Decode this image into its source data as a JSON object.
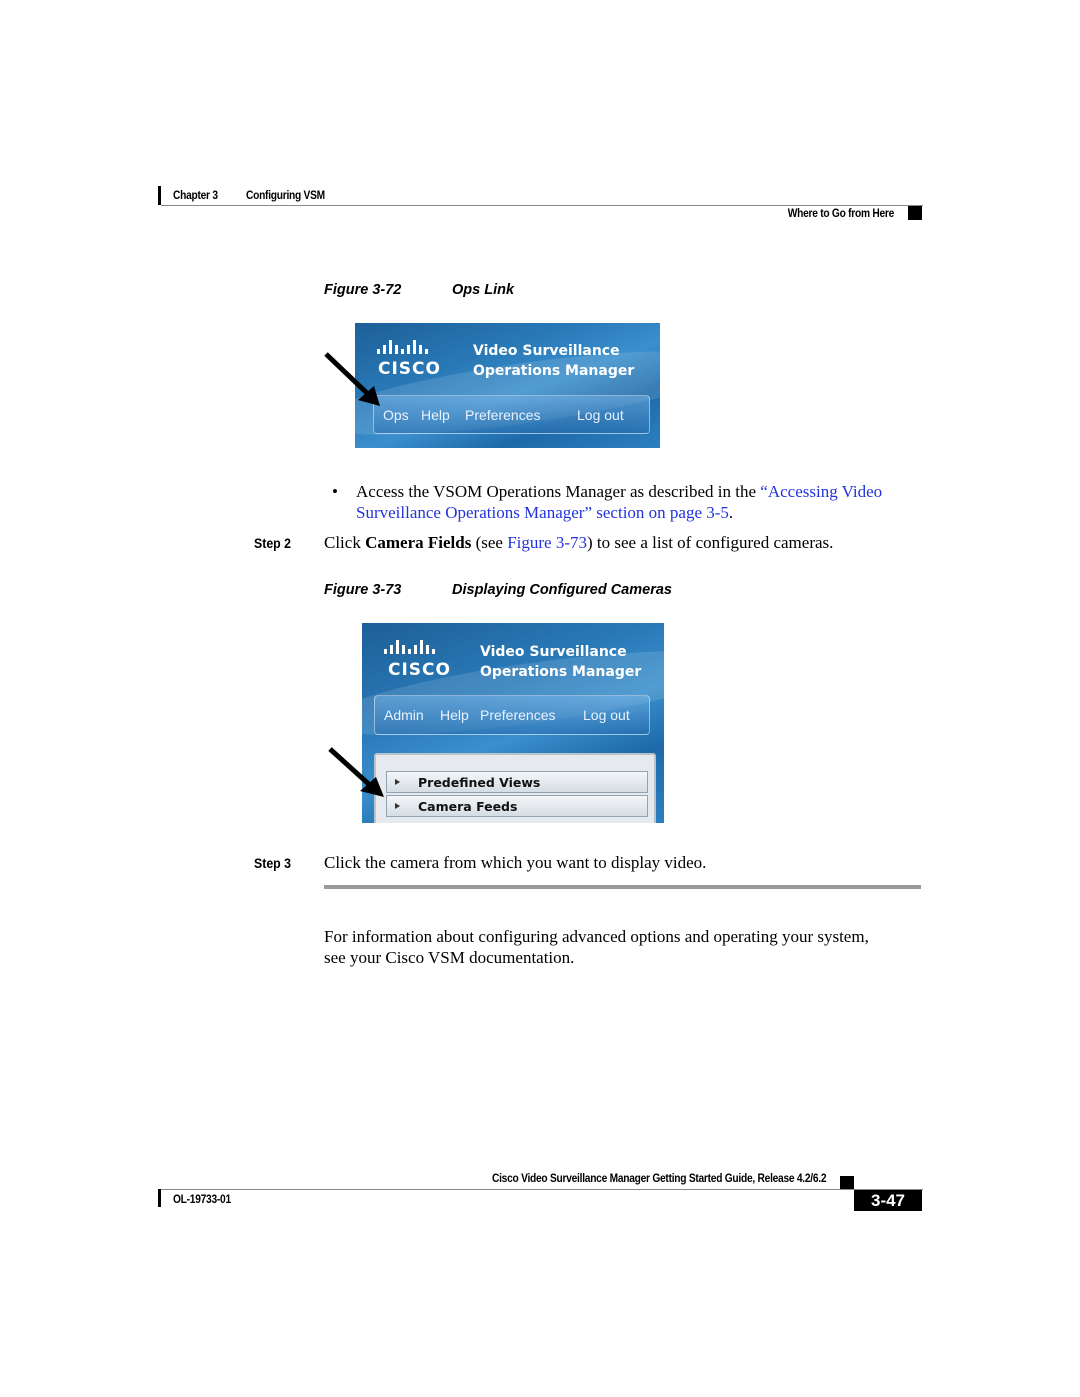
{
  "header": {
    "chapter": "Chapter 3",
    "chapter_title": "Configuring VSM",
    "section": "Where to Go from Here"
  },
  "figure_72": {
    "number": "Figure 3-72",
    "title": "Ops Link",
    "screenshot": {
      "logo_text": "CISCO",
      "app_title_line1": "Video Surveillance",
      "app_title_line2": "Operations Manager",
      "nav": [
        "Ops",
        "Help",
        "Preferences",
        "Log out"
      ]
    }
  },
  "bullet": {
    "text": "Access the VSOM Operations Manager as described in the ",
    "link_line1": "“Accessing Video",
    "link_line2": "Surveillance Operations Manager” section on page 3-5",
    "end": "."
  },
  "step2": {
    "label": "Step 2",
    "text_before": "Click ",
    "bold": "Camera Fields",
    "text_mid": " (see ",
    "link": "Figure 3-73",
    "text_after": ") to see a list of configured cameras."
  },
  "figure_73": {
    "number": "Figure 3-73",
    "title": "Displaying Configured Cameras",
    "screenshot": {
      "logo_text": "CISCO",
      "app_title_line1": "Video Surveillance",
      "app_title_line2": "Operations Manager",
      "nav": [
        "Admin",
        "Help",
        "Preferences",
        "Log out"
      ],
      "panel_items": [
        "Predefined Views",
        "Camera Feeds"
      ]
    }
  },
  "step3": {
    "label": "Step 3",
    "text": "Click the camera from which you want to display video."
  },
  "closing": {
    "line1": "For information about configuring advanced options and operating your system,",
    "line2": "see your Cisco VSM documentation."
  },
  "footer": {
    "guide_title": "Cisco Video Surveillance Manager Getting Started Guide, Release 4.2/6.2",
    "doc_id": "OL-19733-01",
    "page_number": "3-47"
  }
}
